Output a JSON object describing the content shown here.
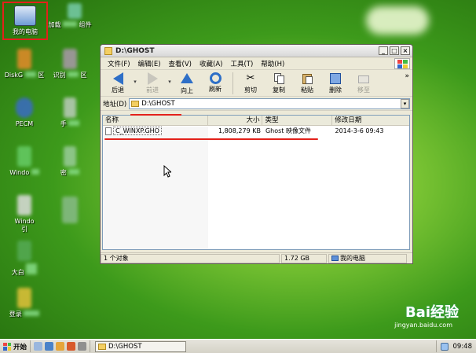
{
  "desktop": {
    "icons": [
      {
        "label": "我的电脑"
      },
      {
        "label": "加载"
      },
      {
        "label": "组件"
      },
      {
        "label": "DiskG"
      },
      {
        "label": "区"
      },
      {
        "label": "识别"
      },
      {
        "label": "区"
      },
      {
        "label": "PECM"
      },
      {
        "label": "手"
      },
      {
        "label": "Windo"
      },
      {
        "label": "密"
      },
      {
        "label": "Windo"
      },
      {
        "label": "引"
      },
      {
        "label": "大白"
      },
      {
        "label": "登录"
      }
    ]
  },
  "window": {
    "title": "D:\\GHOST",
    "menu": [
      "文件(F)",
      "编辑(E)",
      "查看(V)",
      "收藏(A)",
      "工具(T)",
      "帮助(H)"
    ],
    "toolbar": {
      "back": "后退",
      "forward": "前进",
      "up": "向上",
      "refresh": "刷新",
      "cut": "剪切",
      "copy": "复制",
      "paste": "粘贴",
      "delete": "删除",
      "move": "移至",
      "more": "»"
    },
    "address": {
      "label": "地址(D)",
      "value": "D:\\GHOST"
    },
    "columns": {
      "name": "名称",
      "size": "大小",
      "type": "类型",
      "date": "修改日期"
    },
    "files": [
      {
        "name": "C_WINXP.GHO",
        "size": "1,808,279 KB",
        "type": "Ghost 映像文件",
        "date": "2014-3-6 09:43"
      }
    ],
    "status": {
      "count": "1 个对象",
      "size": "1.72 GB",
      "location": "我的电脑"
    }
  },
  "taskbar": {
    "start": "开始",
    "task": "D:\\GHOST",
    "clock": "09:48"
  },
  "watermark": {
    "brand": "Bai经验",
    "url": "jingyan.baidu.com"
  },
  "colors": {
    "desktop": "#5fb02a",
    "highlight": "#e3211b",
    "window": "#ece9d8"
  }
}
